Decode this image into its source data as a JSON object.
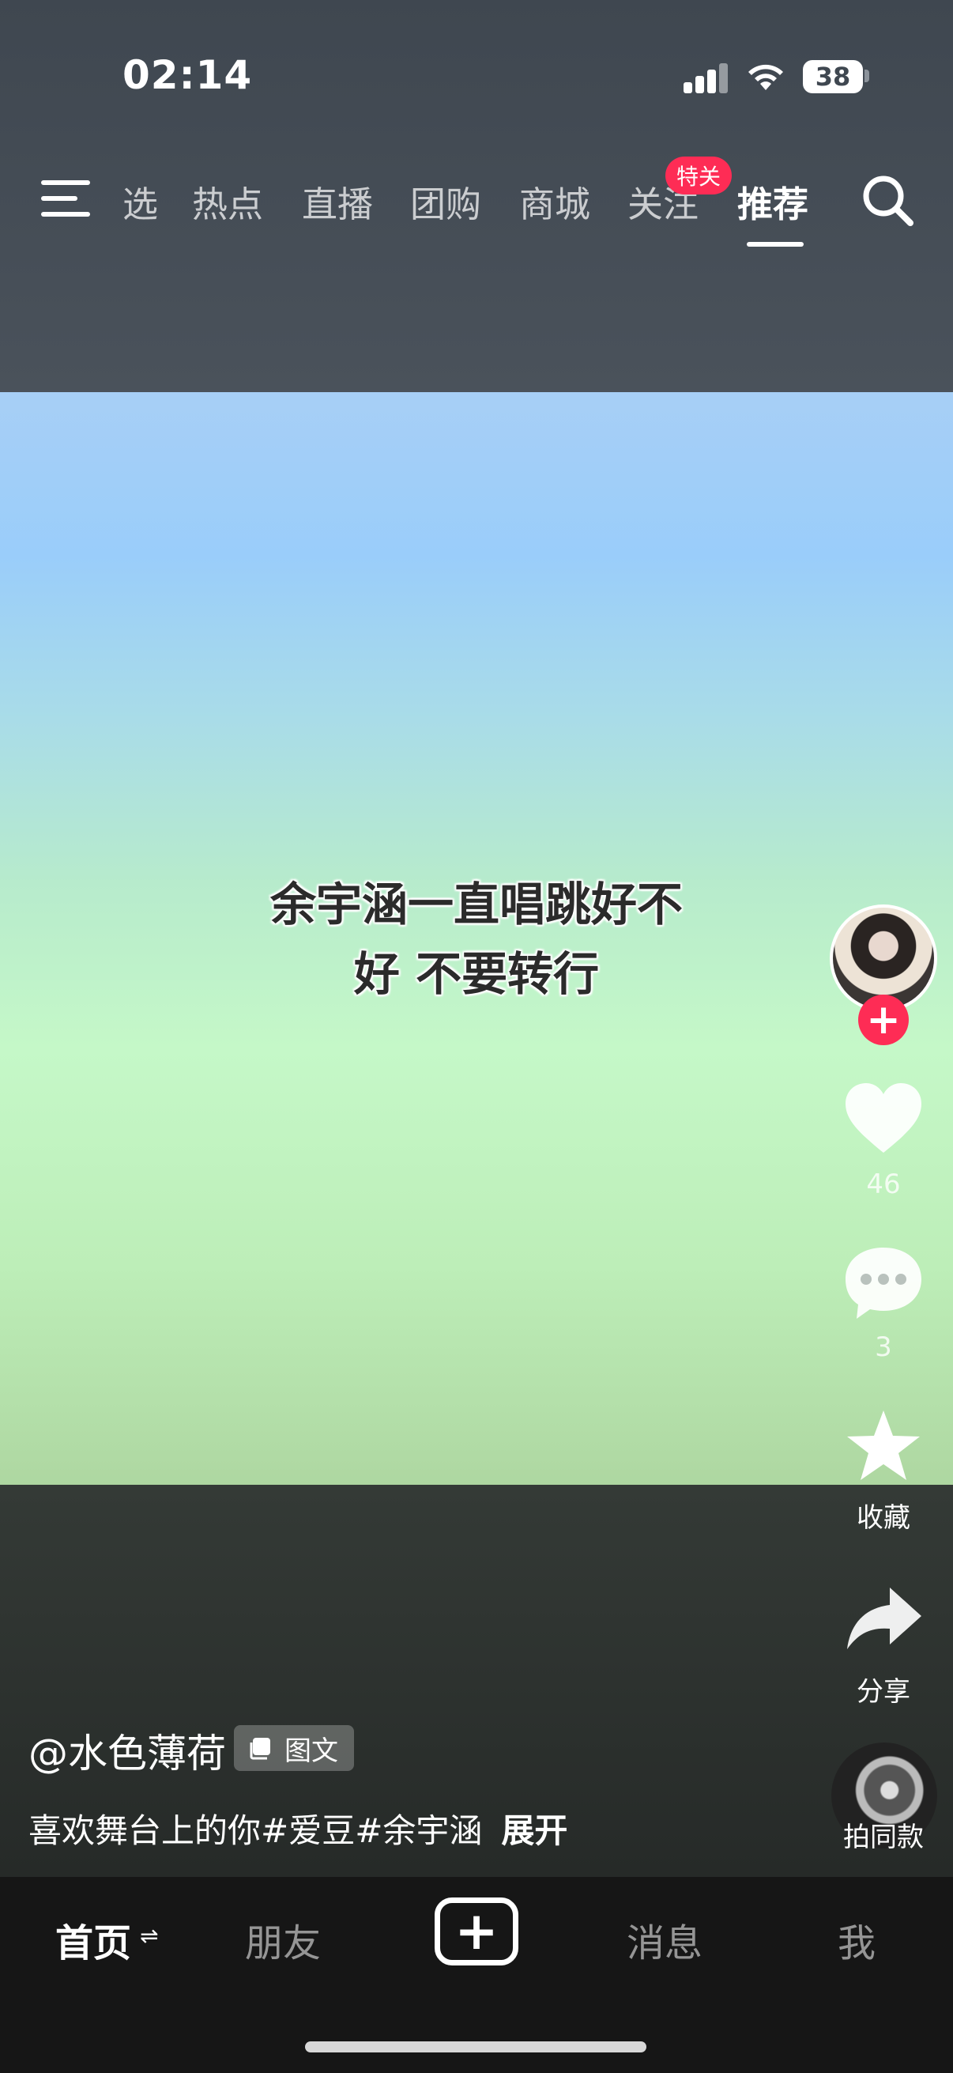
{
  "status_bar": {
    "time": "02:14",
    "battery": "38"
  },
  "top_tabs": [
    {
      "label": "选",
      "active": false
    },
    {
      "label": "热点",
      "active": false
    },
    {
      "label": "直播",
      "active": false
    },
    {
      "label": "团购",
      "active": false
    },
    {
      "label": "商城",
      "active": false
    },
    {
      "label": "关注",
      "active": false
    },
    {
      "label": "推荐",
      "active": true
    }
  ],
  "follow_badge": "特关",
  "post": {
    "caption": "余宇涵一直唱跳好不\n好 不要转行",
    "author": "@水色薄荷",
    "type_label": "图文",
    "description": "喜欢舞台上的你#爱豆#余宇涵",
    "expand_label": "展开"
  },
  "actions": {
    "likes": "46",
    "comments": "3",
    "favorite_label": "收藏",
    "share_label": "分享",
    "same_style_label": "拍同款"
  },
  "bottom_nav": {
    "home": "首页",
    "friends": "朋友",
    "messages": "消息",
    "me": "我"
  },
  "colors": {
    "accent": "#fe2c55",
    "nav_bg": "#161616"
  }
}
